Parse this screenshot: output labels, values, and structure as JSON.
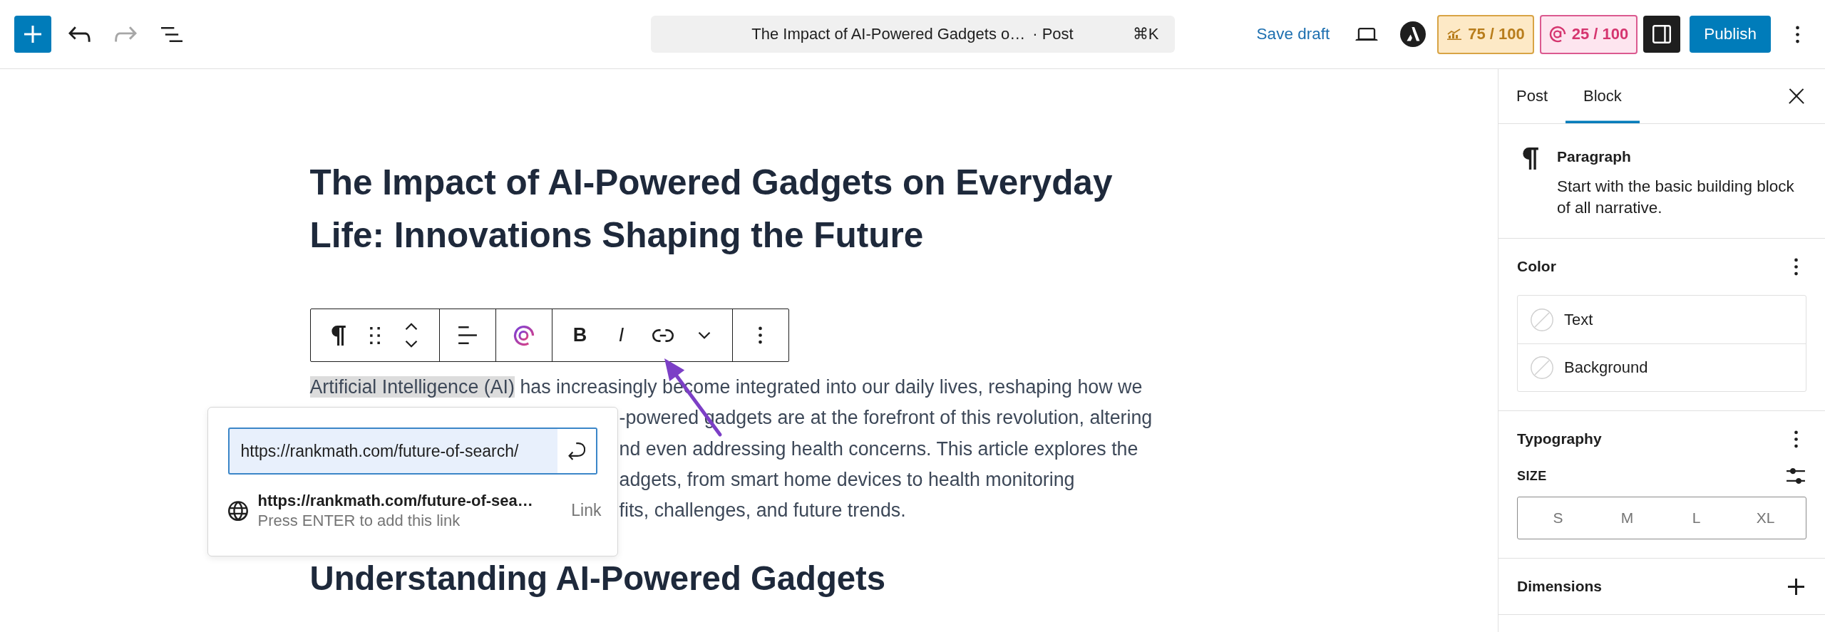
{
  "header": {
    "history": [
      {
        "kind": "undo",
        "disabled": false
      },
      {
        "kind": "redo",
        "disabled": true
      }
    ],
    "command_bar": {
      "title": "The Impact of AI-Powered Gadgets o…",
      "type": "· Post",
      "shortcut": "⌘K"
    },
    "save_draft": "Save draft",
    "scores": [
      {
        "kind": "seo",
        "value": "75 / 100"
      },
      {
        "kind": "ai",
        "value": "25 / 100"
      }
    ],
    "settings_toggle": {
      "pressed": true
    },
    "publish": "Publish"
  },
  "editor": {
    "title": "The Impact of AI-Powered Gadgets on Everyday Life: Innovations Shaping the Future",
    "block_toolbar": {
      "groups": [
        [
          {
            "kind": "paragraph"
          },
          {
            "kind": "drag"
          },
          {
            "kind": "mover"
          }
        ],
        [
          {
            "kind": "align"
          }
        ],
        [
          {
            "kind": "ai"
          }
        ],
        [
          {
            "kind": "bold",
            "label": "B"
          },
          {
            "kind": "italic",
            "label": "I"
          },
          {
            "kind": "link"
          },
          {
            "kind": "more"
          }
        ],
        [
          {
            "kind": "options"
          }
        ]
      ]
    },
    "paragraph": {
      "lines": [
        {
          "partly_hidden": false,
          "segments": [
            {
              "text": "Artificial Intelligence (AI)",
              "selected": true
            },
            {
              "text": "has increasingly become integrated into our daily lives, reshaping how we",
              "selected": false
            }
          ]
        },
        {
          "partly_hidden": true,
          "segments": [
            {
              "text": "-powered gadgets are at the forefront of this revolution, altering",
              "selected": false
            }
          ]
        },
        {
          "partly_hidden": true,
          "segments": [
            {
              "text": "nd even addressing health concerns. This article explores the",
              "selected": false
            }
          ]
        },
        {
          "partly_hidden": true,
          "segments": [
            {
              "text": "adgets, from smart home devices to health monitoring",
              "selected": false
            }
          ]
        },
        {
          "partly_hidden": true,
          "segments": [
            {
              "text": "fits, challenges, and future trends.",
              "selected": false
            }
          ]
        }
      ]
    },
    "link_popup": {
      "url": "https://rankmath.com/future-of-search/",
      "suggestion": {
        "url": "https://rankmath.com/future-of-sea…",
        "hint": "Press ENTER to add this link",
        "type": "Link"
      }
    },
    "heading": "Understanding AI-Powered Gadgets"
  },
  "sidebar": {
    "tabs": [
      {
        "label": "Post",
        "selected": false
      },
      {
        "label": "Block",
        "selected": true
      }
    ],
    "block_card": {
      "title": "Paragraph",
      "description": "Start with the basic building block of all narrative."
    },
    "panels": [
      {
        "kind": "color",
        "title": "Color",
        "items": [
          {
            "label": "Text"
          },
          {
            "label": "Background"
          }
        ]
      },
      {
        "kind": "typography",
        "title": "Typography",
        "size_label": "SIZE",
        "sizes": [
          {
            "label": "S",
            "selected": false
          },
          {
            "label": "M",
            "selected": false
          },
          {
            "label": "L",
            "selected": false
          },
          {
            "label": "XL",
            "selected": false
          }
        ]
      },
      {
        "kind": "dimensions",
        "title": "Dimensions"
      }
    ]
  }
}
